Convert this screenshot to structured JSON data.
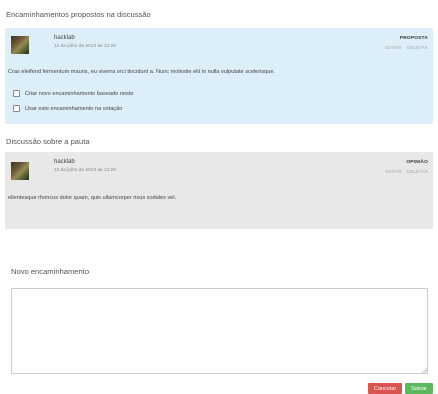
{
  "proposals": {
    "title": "Encaminhamentos propostos na discussão",
    "post": {
      "author": "hacklab",
      "date": "12 de julho de 2013 às 12:26",
      "tag": "PROPOSTA",
      "edit_label": "EDITAR",
      "delete_label": "DELETAR",
      "body": "Cras eleifend fermentum mauris, eu viverra orci tincidunt a. Nunc molestie elit in nulla vulputate scelerisque.",
      "options": [
        "Criar novo encaminhamento baseado neste",
        "Usar este encaminhamento na votação"
      ]
    }
  },
  "discussion": {
    "title": "Discussão sobre a pauta",
    "post": {
      "author": "hacklab",
      "date": "12 de julho de 2013 às 12:26",
      "tag": "OPINIÃO",
      "edit_label": "EDITAR",
      "delete_label": "DELETAR",
      "body": "ellentesque rhoncus dolor quam, quis ullamcorper risus sodales vel."
    }
  },
  "new_proposal": {
    "title": "Novo encaminhamento",
    "textarea_value": "",
    "cancel_label": "Cancelar",
    "save_label": "Salvar"
  },
  "colors": {
    "proposal_bg": "#dceef8",
    "discussion_bg": "#e8e8e8",
    "cancel": "#d9534f",
    "save": "#5cb85c"
  }
}
